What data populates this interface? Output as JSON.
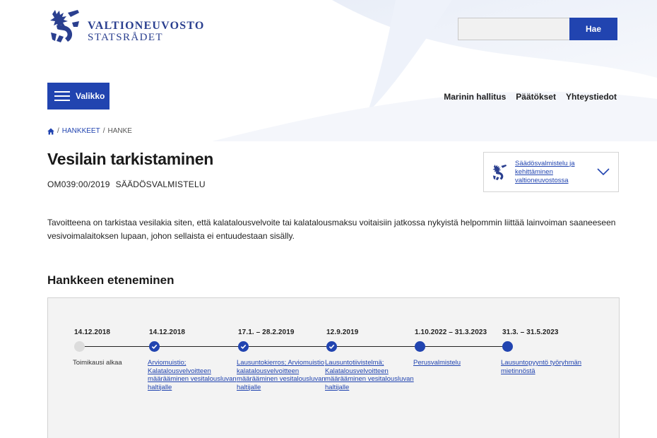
{
  "brand": {
    "name_fi": "VALTIONEUVOSTO",
    "name_sv": "STATSRÅDET",
    "accent_color": "#2144b0"
  },
  "search": {
    "value": "",
    "placeholder": "",
    "button_label": "Hae"
  },
  "menu": {
    "label": "Valikko",
    "icon": "hamburger-icon"
  },
  "topnav": {
    "items": [
      "Marinin hallitus",
      "Päätökset",
      "Yhteystiedot"
    ]
  },
  "breadcrumb": {
    "home_icon": "home-icon",
    "items": [
      "HANKKEET",
      "HANKE"
    ],
    "separator": "/"
  },
  "project": {
    "title": "Vesilain tarkistaminen",
    "id": "OM039:00/2019",
    "type": "SÄÄDÖSVALMISTELU",
    "guide_link": "Säädösvalmistelu ja kehittäminen valtioneuvostossa",
    "lead": "Tavoitteena on tarkistaa vesilakia siten, että kalatalousvelvoite tai kalatalousmaksu voitaisiin jatkossa nykyistä helpommin liittää lainvoiman saaneeseen vesivoimalaitoksen lupaan, johon sellaista ei entuudestaan sisälly."
  },
  "progress": {
    "title": "Hankkeen eteneminen",
    "steps": [
      {
        "date": "14.12.2018",
        "label": "Toimikausi alkaa",
        "status": "pending",
        "link": false
      },
      {
        "date": "14.12.2018",
        "label": "Arviomuistio; Kalatalousvelvoitteen määrääminen vesitalousluvan haltijalle",
        "status": "done",
        "link": true
      },
      {
        "date": "17.1. – 28.2.2019",
        "label": "Lausuntokierros; Arviomuistio kalatalousvelvoitteen määrääminen vesitalousluvan haltijalle",
        "status": "done",
        "link": true
      },
      {
        "date": "12.9.2019",
        "label": "Lausuntotiivistelmä; Kalatalousvelvoitteen määrääminen vesitalousluvan haltijalle",
        "status": "done",
        "link": true
      },
      {
        "date": "1.10.2022 – 31.3.2023",
        "label": "Perusvalmistelu",
        "status": "active",
        "link": true
      },
      {
        "date": "31.3. – 31.5.2023",
        "label": "Lausuntopyyntö työryhmän mietinnöstä",
        "status": "active",
        "link": true
      }
    ]
  }
}
